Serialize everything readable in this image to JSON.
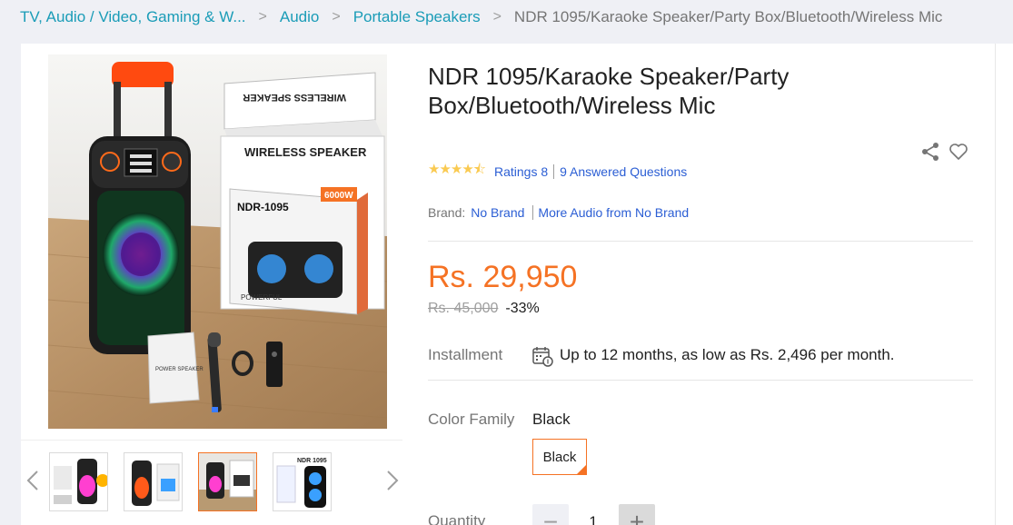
{
  "breadcrumb": {
    "items": [
      "TV, Audio / Video, Gaming & W...",
      "Audio",
      "Portable Speakers"
    ],
    "current": "NDR 1095/Karaoke Speaker/Party Box/Bluetooth/Wireless Mic"
  },
  "product": {
    "title": "NDR 1095/Karaoke Speaker/Party Box/Bluetooth/Wireless Mic",
    "rating_stars": 4.5,
    "ratings_label": "Ratings 8",
    "questions_label": "9 Answered Questions",
    "brand_label": "Brand:",
    "brand_name": "No Brand",
    "more_from_brand": "More Audio from No Brand",
    "price": "Rs. 29,950",
    "old_price": "Rs. 45,000",
    "discount": "-33%",
    "installment_label": "Installment",
    "installment_text": "Up to 12 months, as low as Rs. 2,496 per month.",
    "color_family_label": "Color Family",
    "color_family_value": "Black",
    "color_options": [
      "Black"
    ],
    "quantity_label": "Quantity",
    "quantity_value": "1",
    "qty_minus": "−",
    "qty_plus": "+"
  },
  "image_text": {
    "box_top": "WIRELESS SPEAKER",
    "box_front": "WIRELESS SPEAKER",
    "model": "NDR-1095",
    "wattage": "6000W",
    "powerful": "POWERFUL",
    "manual": "POWER SPEAKER",
    "thumb_label": "NDR 1095"
  },
  "icons": {
    "share": "share-icon",
    "wishlist": "heart-icon",
    "installment": "calendar-icon",
    "prev": "chevron-left-icon",
    "next": "chevron-right-icon"
  },
  "colors": {
    "accent": "#f57224",
    "link": "#2b5ed4",
    "breadcrumb_link": "#1a9cb7",
    "star": "#faca51"
  }
}
